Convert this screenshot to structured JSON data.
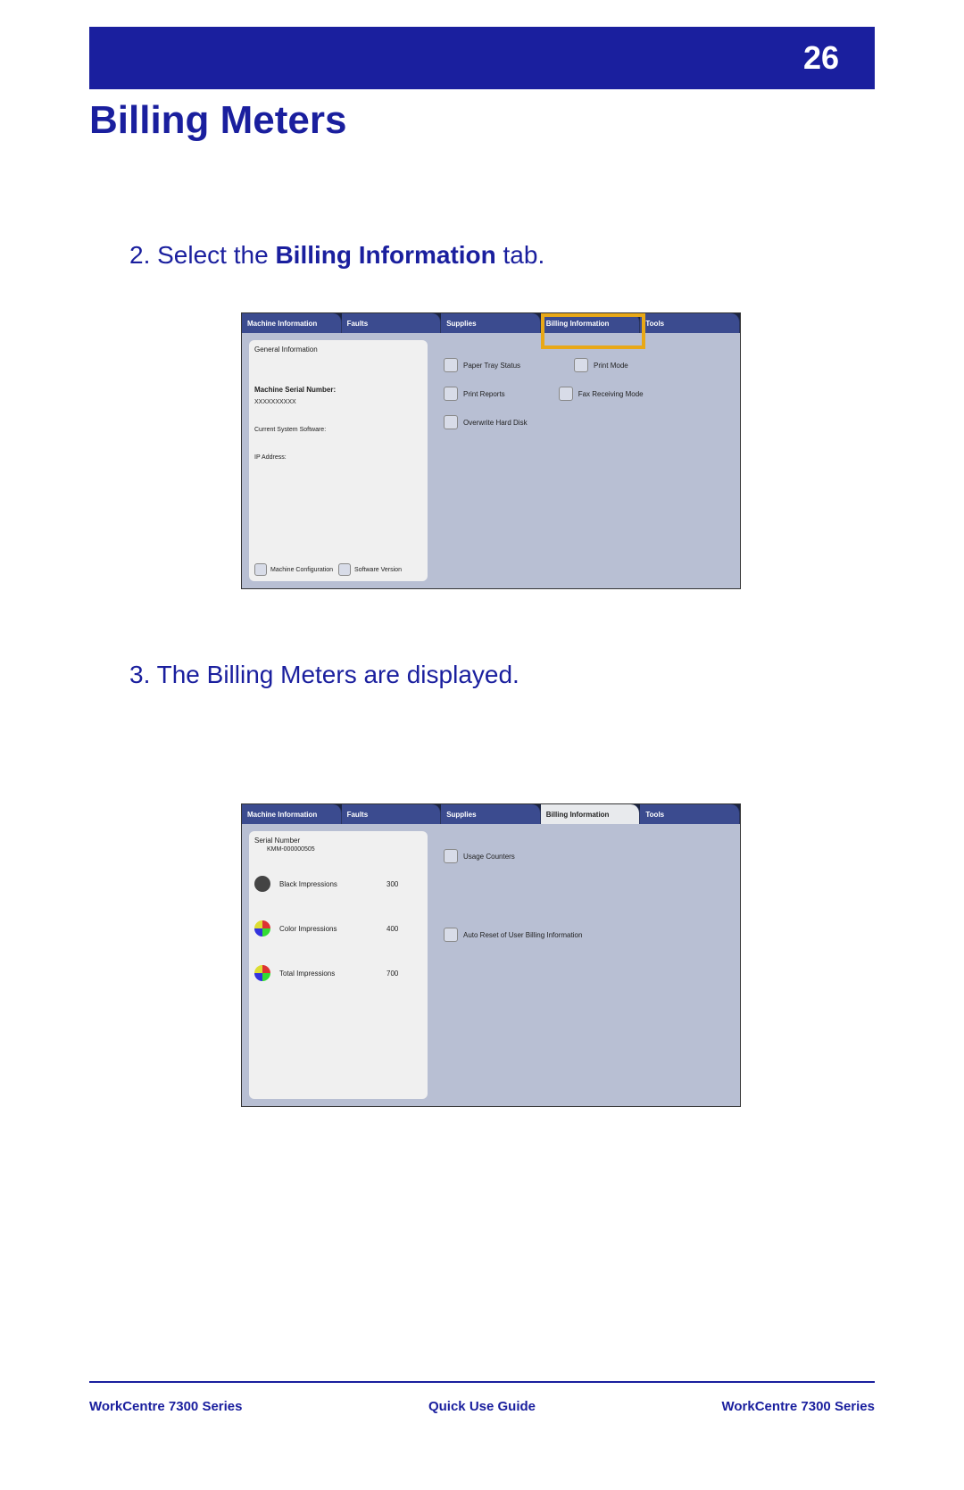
{
  "page_number": "26",
  "title": "Billing Meters",
  "step2_prefix": "2. Select the ",
  "step2_bold": "Billing Information",
  "step2_suffix": " tab.",
  "step3": "3. The Billing Meters are displayed.",
  "shot1": {
    "tabs": [
      "Machine Information",
      "Faults",
      "Supplies",
      "Billing Information",
      "Tools"
    ],
    "left": {
      "general": "General Information",
      "serial_label": "Machine Serial Number:",
      "serial_val": "XXXXXXXXXX",
      "software_label": "Current System Software:",
      "ip_label": "IP Address:",
      "btn1": "Machine Configuration",
      "btn2": "Software Version"
    },
    "right": {
      "r1a": "Paper Tray Status",
      "r1b": "Print Mode",
      "r2a": "Print Reports",
      "r2b": "Fax Receiving Mode",
      "r3a": "Overwrite Hard Disk"
    }
  },
  "shot2": {
    "tabs": [
      "Machine Information",
      "Faults",
      "Supplies",
      "Billing Information",
      "Tools"
    ],
    "left": {
      "serial_label": "Serial Number",
      "serial_val": "KMM-000000505",
      "m1_label": "Black Impressions",
      "m1_val": "300",
      "m2_label": "Color Impressions",
      "m2_val": "400",
      "m3_label": "Total Impressions",
      "m3_val": "700"
    },
    "right": {
      "r1": "Usage Counters",
      "r2": "Auto Reset of User Billing Information"
    }
  },
  "footer": {
    "left": "WorkCentre 7300 Series",
    "center": "Quick Use Guide",
    "right": "WorkCentre 7300 Series"
  }
}
